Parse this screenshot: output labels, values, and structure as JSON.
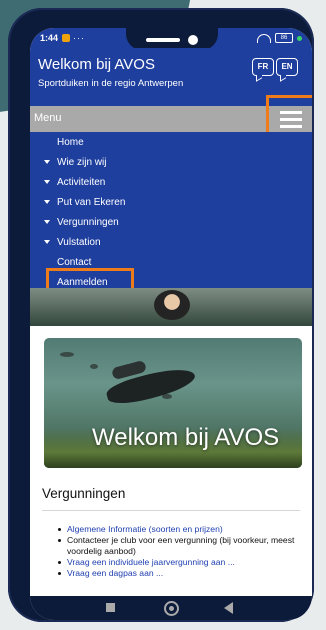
{
  "status": {
    "time": "1:44",
    "dots": "···",
    "battery": "86"
  },
  "header": {
    "title": "Welkom bij AVOS",
    "subtitle": "Sportduiken in de regio Antwerpen",
    "lang_fr": "FR",
    "lang_en": "EN"
  },
  "menubar": {
    "label": "Menu"
  },
  "nav": {
    "items": [
      {
        "label": "Home",
        "has_arrow": false
      },
      {
        "label": "Wie zijn wij",
        "has_arrow": true
      },
      {
        "label": "Activiteiten",
        "has_arrow": true
      },
      {
        "label": "Put van Ekeren",
        "has_arrow": true
      },
      {
        "label": "Vergunningen",
        "has_arrow": true
      },
      {
        "label": "Vulstation",
        "has_arrow": true
      },
      {
        "label": "Contact",
        "has_arrow": false
      },
      {
        "label": "Aanmelden",
        "has_arrow": false
      }
    ]
  },
  "hero": {
    "title": "Welkom bij AVOS"
  },
  "section": {
    "title": "Vergunningen",
    "items": [
      {
        "text": "Algemene Informatie (soorten en prijzen)",
        "link": true
      },
      {
        "text": "Contacteer je club voor een vergunning (bij voorkeur, meest voordelig aanbod)",
        "link": false
      },
      {
        "text": "Vraag een individuele jaarvergunning aan ...",
        "link": true
      },
      {
        "text": "Vraag een dagpas aan ...",
        "link": true
      }
    ]
  },
  "colors": {
    "brand": "#1f3f9f",
    "highlight": "#ef7c1a",
    "menubar": "#a9a9a9",
    "frame": "#0d1b3a"
  },
  "icons": {
    "hamburger": "hamburger-menu-icon",
    "lang": "speech-bubble-icon",
    "nav_arrow": "chevron-down-icon"
  }
}
